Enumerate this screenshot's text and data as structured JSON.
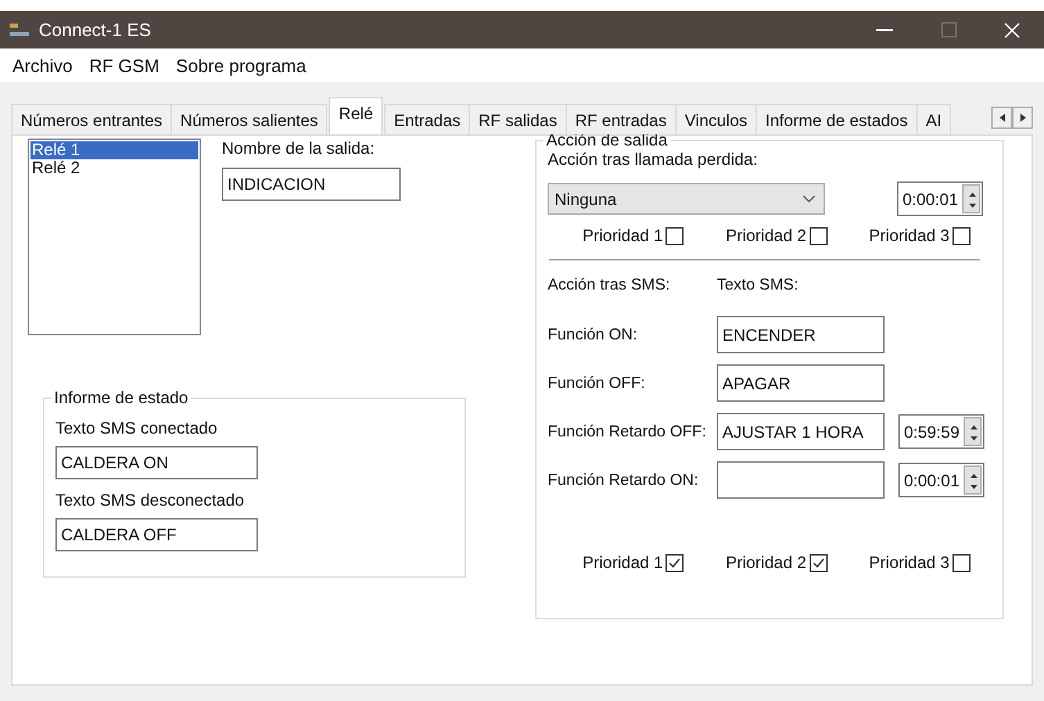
{
  "window": {
    "title": "Connect-1 ES"
  },
  "menu": [
    "Archivo",
    "RF GSM",
    "Sobre programa"
  ],
  "tabs": [
    {
      "label": "Números entrantes",
      "selected": false
    },
    {
      "label": "Números salientes",
      "selected": false
    },
    {
      "label": "Relé",
      "selected": true
    },
    {
      "label": "Entradas",
      "selected": false
    },
    {
      "label": "RF salidas",
      "selected": false
    },
    {
      "label": "RF entradas",
      "selected": false
    },
    {
      "label": "Vinculos",
      "selected": false
    },
    {
      "label": "Informe de estados",
      "selected": false
    },
    {
      "label": "AI",
      "selected": false
    }
  ],
  "relays": [
    {
      "label": "Relé 1",
      "selected": true
    },
    {
      "label": "Relé 2",
      "selected": false
    }
  ],
  "output_name": {
    "label": "Nombre de la salida:",
    "value": "INDICACION"
  },
  "status_report": {
    "title": "Informe de estado",
    "fields": [
      {
        "label": "Texto SMS conectado",
        "value": "CALDERA ON"
      },
      {
        "label": "Texto SMS desconectado",
        "value": "CALDERA OFF"
      }
    ]
  },
  "output_action": {
    "title": "Acción de salida",
    "missed_call": {
      "label": "Acción tras llamada perdida:",
      "action": "Ninguna",
      "time": "0:00:01",
      "priorities": [
        {
          "label": "Prioridad 1",
          "checked": false
        },
        {
          "label": "Prioridad 2",
          "checked": false
        },
        {
          "label": "Prioridad 3",
          "checked": false
        }
      ]
    },
    "sms": {
      "headers": [
        "Acción tras SMS:",
        "Texto SMS:"
      ],
      "rows": [
        {
          "label": "Función ON:",
          "value": "ENCENDER"
        },
        {
          "label": "Función OFF:",
          "value": "APAGAR"
        },
        {
          "label": "Función Retardo OFF:",
          "value": "AJUSTAR 1 HORA",
          "time": "0:59:59"
        },
        {
          "label": "Función Retardo ON:",
          "value": "",
          "time": "0:00:01"
        }
      ],
      "priorities": [
        {
          "label": "Prioridad 1",
          "checked": true
        },
        {
          "label": "Prioridad 2",
          "checked": true
        },
        {
          "label": "Prioridad 3",
          "checked": false
        }
      ]
    }
  }
}
